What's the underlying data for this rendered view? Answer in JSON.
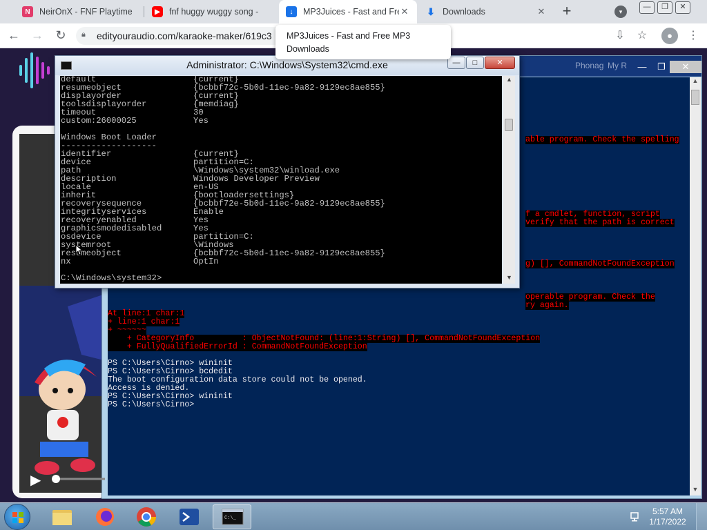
{
  "browser": {
    "tabs": [
      {
        "title": "NeirOnX - FNF Playtime",
        "favicon_color": "#e23c6b"
      },
      {
        "title": "fnf huggy wuggy song -",
        "favicon_color": "#ff0000"
      },
      {
        "title": "MP3Juices - Fast and Free",
        "favicon_color": "#1a73e8"
      },
      {
        "title": "Downloads",
        "favicon_color": "#1a73e8"
      }
    ],
    "url": "edityouraudio.com/karaoke-maker/619c3",
    "tooltip": {
      "line1": "MP3Juices - Fast and Free MP3",
      "line2": "Downloads"
    }
  },
  "powershell": {
    "title": "",
    "menu_fragments": [
      "Phonag",
      "My R"
    ],
    "lines": [
      {
        "text": "able program. Check the spelling",
        "err": true
      },
      {
        "text": "f a cmdlet, function, script",
        "err": true
      },
      {
        "text": "verify that the path is correct",
        "err": true
      },
      {
        "text": "g) [], CommandNotFoundException",
        "err": true
      },
      {
        "text": "operable program. Check the",
        "err": true
      },
      {
        "text": "ry again.",
        "err": true
      },
      {
        "text": "At line:1 char:1",
        "err": true
      },
      {
        "text": "+ line:1 char:1",
        "err": true
      },
      {
        "text": "+ ~~~~~~",
        "err": true
      },
      {
        "text": "    + CategoryInfo          : ObjectNotFound: (line:1:String) [], CommandNotFoundException",
        "err": true
      },
      {
        "text": "    + FullyQualifiedErrorId : CommandNotFoundException",
        "err": true
      },
      {
        "text": "",
        "err": false
      },
      {
        "text": "PS C:\\Users\\Cirno> wininit",
        "err": false
      },
      {
        "text": "PS C:\\Users\\Cirno> bcdedit",
        "err": false
      },
      {
        "text": "The boot configuration data store could not be opened.",
        "err": false
      },
      {
        "text": "Access is denied.",
        "err": false
      },
      {
        "text": "PS C:\\Users\\Cirno> wininit",
        "err": false
      },
      {
        "text": "PS C:\\Users\\Cirno>",
        "err": false
      }
    ]
  },
  "cmd": {
    "title": "Administrator: C:\\Windows\\System32\\cmd.exe",
    "rows": [
      {
        "key": "default",
        "value": "{current}"
      },
      {
        "key": "resumeobject",
        "value": "{bcbbf72c-5b0d-11ec-9a82-9129ec8ae855}"
      },
      {
        "key": "displayorder",
        "value": "{current}"
      },
      {
        "key": "toolsdisplayorder",
        "value": "{memdiag}"
      },
      {
        "key": "timeout",
        "value": "30"
      },
      {
        "key": "custom:26000025",
        "value": "Yes"
      },
      {
        "key": "",
        "value": ""
      },
      {
        "key": "Windows Boot Loader",
        "value": ""
      },
      {
        "key": "-------------------",
        "value": ""
      },
      {
        "key": "identifier",
        "value": "{current}"
      },
      {
        "key": "device",
        "value": "partition=C:"
      },
      {
        "key": "path",
        "value": "\\Windows\\system32\\winload.exe"
      },
      {
        "key": "description",
        "value": "Windows Developer Preview"
      },
      {
        "key": "locale",
        "value": "en-US"
      },
      {
        "key": "inherit",
        "value": "{bootloadersettings}"
      },
      {
        "key": "recoverysequence",
        "value": "{bcbbf72e-5b0d-11ec-9a82-9129ec8ae855}"
      },
      {
        "key": "integrityservices",
        "value": "Enable"
      },
      {
        "key": "recoveryenabled",
        "value": "Yes"
      },
      {
        "key": "graphicsmodedisabled",
        "value": "Yes"
      },
      {
        "key": "osdevice",
        "value": "partition=C:"
      },
      {
        "key": "systemroot",
        "value": "\\Windows"
      },
      {
        "key": "resumeobject",
        "value": "{bcbbf72c-5b0d-11ec-9a82-9129ec8ae855}"
      },
      {
        "key": "nx",
        "value": "OptIn"
      },
      {
        "key": "",
        "value": ""
      },
      {
        "key": "C:\\Windows\\system32>",
        "value": ""
      }
    ]
  },
  "taskbar": {
    "apps": [
      "windows-explorer",
      "firefox",
      "chrome",
      "powershell",
      "cmd"
    ],
    "time": "5:57 AM",
    "date": "1/17/2022"
  }
}
